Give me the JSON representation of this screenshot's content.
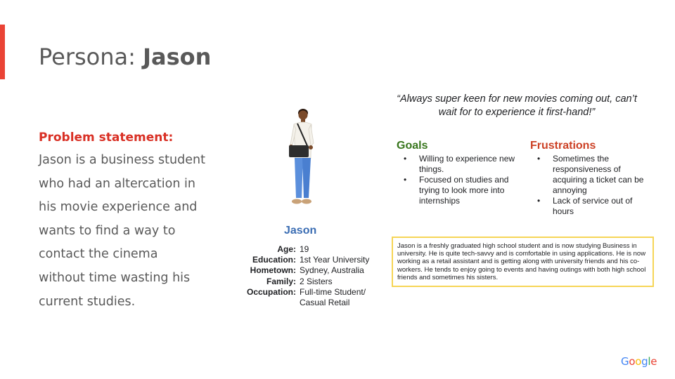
{
  "title": {
    "prefix": "Persona: ",
    "name": "Jason"
  },
  "problem": {
    "label": "Problem statement:",
    "text": "Jason is a business student who had an altercation in his movie experience and wants to find a way to contact the cinema without time wasting his current studies."
  },
  "persona": {
    "name": "Jason",
    "details": [
      {
        "label": "Age:",
        "value": "19"
      },
      {
        "label": "Education:",
        "value": "1st Year University"
      },
      {
        "label": "Hometown:",
        "value": "Sydney, Australia"
      },
      {
        "label": "Family:",
        "value": "2 Sisters"
      },
      {
        "label": "Occupation:",
        "value": "Full-time Student/\nCasual Retail"
      }
    ]
  },
  "quote": "“Always super keen for new movies coming out, can’t wait for to experience it first-hand!”",
  "goals": {
    "heading": "Goals",
    "items": [
      "Willing to experience new things.",
      " Focused on studies and trying to look more into internships"
    ]
  },
  "frustrations": {
    "heading": "Frustrations",
    "items": [
      "Sometimes the responsiveness of acquiring a ticket can be annoying",
      "Lack of service out of hours"
    ]
  },
  "bio": "Jason is a freshly graduated high school student and is now studying Business in university. He is quite  tech-savvy and is comfortable in using applications. He is now working as a retail assistant and is getting along with university friends and his co-workers. He tends to enjoy going to events and having outings with both high school friends and sometimes his sisters.",
  "logo": "Google",
  "colors": {
    "accent": "#ea4335",
    "problem_label": "#d93025",
    "goals": "#38761d",
    "frustrations": "#cc4125",
    "persona_name": "#3b6db3",
    "bio_border": "#f6d556"
  }
}
